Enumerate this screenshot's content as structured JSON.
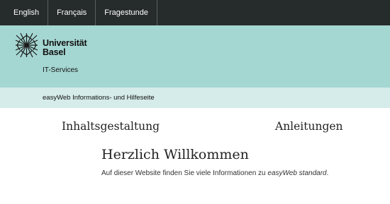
{
  "topbar": {
    "languages": [
      "English",
      "Français",
      "Fragestunde"
    ]
  },
  "brand": {
    "logo_line1": "Universität",
    "logo_line2": "Basel",
    "department": "IT-Services"
  },
  "subbar": {
    "site_title": "easyWeb Informations- und Hilfeseite"
  },
  "nav": {
    "items": [
      "Inhaltsgestaltung",
      "Anleitungen"
    ]
  },
  "main": {
    "heading": "Herzlich Willkommen",
    "intro_prefix": "Auf dieser Website finden Sie viele Informationen zu ",
    "intro_emphasis": "easyWeb standard",
    "intro_suffix": "."
  },
  "colors": {
    "topbar": "#262b2b",
    "brand_band": "#a5d7d2",
    "sub_band": "#d5ecea"
  },
  "icons": [
    "university-logo-icon"
  ]
}
